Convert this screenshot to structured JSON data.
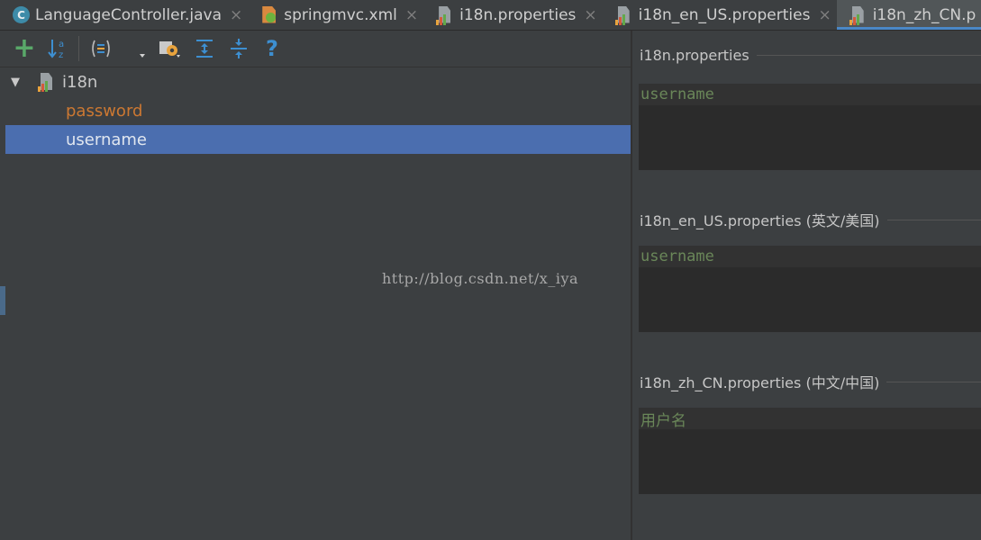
{
  "tabs": [
    {
      "label": "LanguageController.java",
      "icon": "java-class-icon",
      "active": false
    },
    {
      "label": "springmvc.xml",
      "icon": "spring-xml-icon",
      "active": false
    },
    {
      "label": "i18n.properties",
      "icon": "properties-file-icon",
      "active": false
    },
    {
      "label": "i18n_en_US.properties",
      "icon": "properties-file-icon",
      "active": false
    },
    {
      "label": "i18n_zh_CN.p",
      "icon": "properties-file-icon",
      "active": true
    }
  ],
  "close_glyph": "×",
  "toolbar": {
    "add": "+",
    "help": "?"
  },
  "tree": {
    "root": {
      "label": "i18n",
      "expanded": true
    },
    "keys": [
      {
        "label": "password",
        "selected": false
      },
      {
        "label": "username",
        "selected": true
      }
    ]
  },
  "watermark": "http://blog.csdn.net/x_iya",
  "editor": {
    "sections": [
      {
        "title": "i18n.properties",
        "value": "username"
      },
      {
        "title": "i18n_en_US.properties (英文/美国)",
        "value": "username"
      },
      {
        "title": "i18n_zh_CN.properties (中文/中国)",
        "value": "用户名"
      }
    ]
  },
  "colors": {
    "background": "#3c3f41",
    "selection": "#4b6eaf",
    "key_text": "#cc7832",
    "value_text": "#6a8759",
    "tab_underline": "#4a88c7"
  }
}
